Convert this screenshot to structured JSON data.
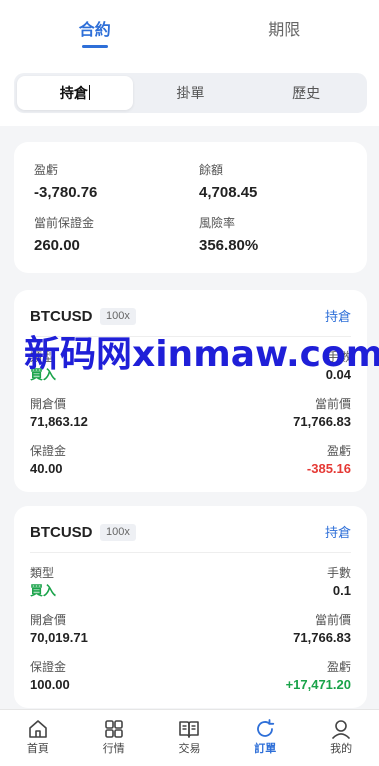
{
  "top_tabs": [
    {
      "label": "合約",
      "active": true
    },
    {
      "label": "期限",
      "active": false
    }
  ],
  "segments": [
    {
      "label": "持倉",
      "active": true
    },
    {
      "label": "掛單",
      "active": false
    },
    {
      "label": "歷史",
      "active": false
    }
  ],
  "summary": {
    "profit_label": "盈虧",
    "profit_value": "-3,780.76",
    "balance_label": "餘額",
    "balance_value": "4,708.45",
    "margin_label": "當前保證金",
    "margin_value": "260.00",
    "risk_label": "風險率",
    "risk_value": "356.80%"
  },
  "positions": [
    {
      "symbol": "BTCUSD",
      "leverage": "100x",
      "status": "持倉",
      "type_label": "類型",
      "type_value": "買入",
      "lots_label": "手數",
      "lots_value": "0.04",
      "open_label": "開倉價",
      "open_value": "71,863.12",
      "current_label": "當前價",
      "current_value": "71,766.83",
      "margin_label": "保證金",
      "margin_value": "40.00",
      "pnl_label": "盈虧",
      "pnl_value": "-385.16"
    },
    {
      "symbol": "BTCUSD",
      "leverage": "100x",
      "status": "持倉",
      "type_label": "類型",
      "type_value": "買入",
      "lots_label": "手數",
      "lots_value": "0.1",
      "open_label": "開倉價",
      "open_value": "70,019.71",
      "current_label": "當前價",
      "current_value": "71,766.83",
      "margin_label": "保證金",
      "margin_value": "100.00",
      "pnl_label": "盈虧",
      "pnl_value": "+17,471.20"
    }
  ],
  "watermark": "新码网xinmaw.com",
  "bottom_nav": [
    {
      "label": "首頁",
      "icon": "home-icon",
      "active": false
    },
    {
      "label": "行情",
      "icon": "grid-icon",
      "active": false
    },
    {
      "label": "交易",
      "icon": "book-icon",
      "active": false
    },
    {
      "label": "訂單",
      "icon": "refresh-icon",
      "active": true
    },
    {
      "label": "我的",
      "icon": "user-icon",
      "active": false
    }
  ],
  "colors": {
    "accent": "#2e6fd8",
    "buy": "#1aa34a",
    "loss": "#e53935"
  }
}
